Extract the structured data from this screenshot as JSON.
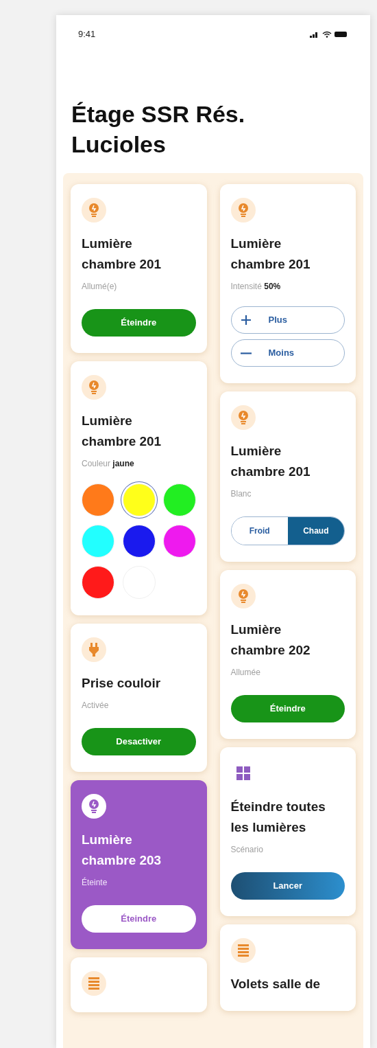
{
  "status_bar": {
    "time": "9:41"
  },
  "title": "Étage SSR Rés. Lucioles",
  "columns": [
    {
      "cards": [
        {
          "kind": "toggle",
          "icon": {
            "kind": "bulb"
          },
          "highlighted": false,
          "title": "Lumière chambre 201",
          "subtitle": "Allumé(e)",
          "button": "Éteindre"
        },
        {
          "kind": "color",
          "icon": {
            "kind": "bulb"
          },
          "highlighted": false,
          "title": "Lumière chambre 201",
          "subtitle": "Couleur **jaune**",
          "swatches": [
            {
              "color": "#ff7a1a",
              "selected": false
            },
            {
              "color": "#ffff1a",
              "selected": true
            },
            {
              "color": "#22ee22",
              "selected": false
            },
            {
              "color": "#22ffff",
              "selected": false
            },
            {
              "color": "#1a1aee",
              "selected": false
            },
            {
              "color": "#ee1aee",
              "selected": false
            },
            {
              "color": "#ff1a1a",
              "selected": false
            },
            {
              "color": "#ffffff",
              "selected": false
            }
          ]
        },
        {
          "kind": "toggle",
          "icon": {
            "kind": "plug"
          },
          "highlighted": false,
          "title": "Prise couloir",
          "subtitle": "Activée",
          "button": "Desactiver"
        },
        {
          "kind": "toggle",
          "icon": {
            "kind": "bulb"
          },
          "highlighted": true,
          "title": "Lumière chambre 203",
          "subtitle": "Éteinte",
          "button": "Éteindre"
        },
        {
          "kind": "partial",
          "icon": {
            "kind": "blinds"
          },
          "highlighted": false
        }
      ]
    },
    {
      "cards": [
        {
          "kind": "intensity",
          "icon": {
            "kind": "bulb"
          },
          "highlighted": false,
          "title": "Lumière chambre 201",
          "subtitle": "Intensité **50%**",
          "plus": "Plus",
          "minus": "Moins"
        },
        {
          "kind": "white",
          "icon": {
            "kind": "bulb"
          },
          "highlighted": false,
          "title": "Lumière chambre 201",
          "subtitle": "Blanc",
          "options": [
            {
              "label": "Froid",
              "selected": false
            },
            {
              "label": "Chaud",
              "selected": true
            }
          ]
        },
        {
          "kind": "toggle",
          "icon": {
            "kind": "bulb"
          },
          "highlighted": false,
          "title": "Lumière chambre 202",
          "subtitle": "Allumée",
          "button": "Éteindre"
        },
        {
          "kind": "scenario",
          "icon": {
            "kind": "grid"
          },
          "highlighted": false,
          "title": "Éteindre toutes les lumières",
          "subtitle": "Scénario",
          "button": "Lancer"
        },
        {
          "kind": "partial",
          "icon": {
            "kind": "blinds"
          },
          "highlighted": false,
          "title": "Volets salle de"
        }
      ]
    }
  ]
}
